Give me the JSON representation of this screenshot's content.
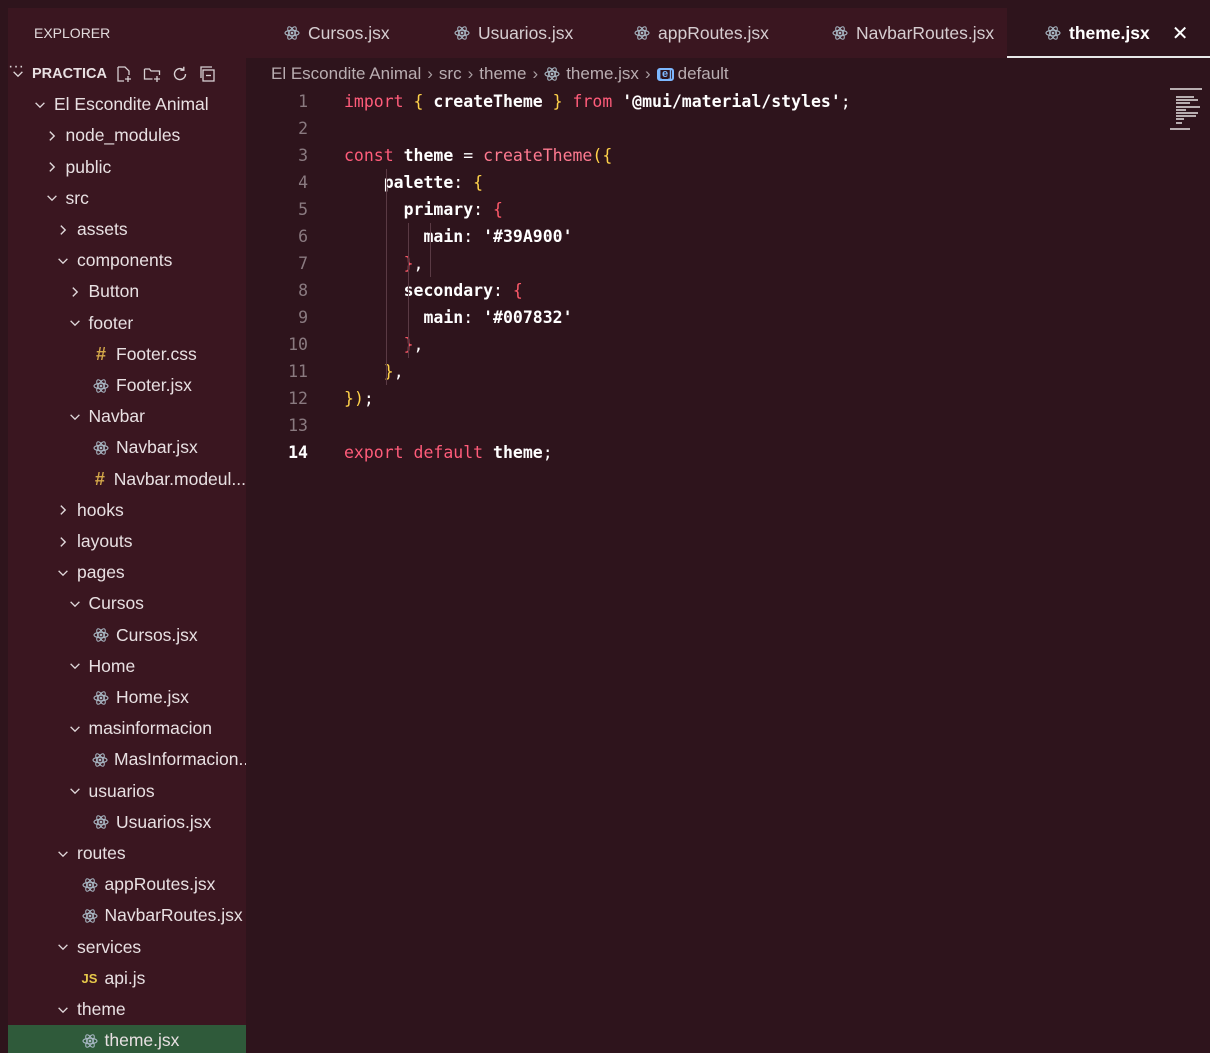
{
  "sidebar": {
    "title": "EXPLORER",
    "more": "···",
    "section": "PRACTICA",
    "items": [
      {
        "label": "El Escondite Animal",
        "type": "folder",
        "expanded": true,
        "indent": 0
      },
      {
        "label": "node_modules",
        "type": "folder",
        "expanded": false,
        "indent": 1
      },
      {
        "label": "public",
        "type": "folder",
        "expanded": false,
        "indent": 1
      },
      {
        "label": "src",
        "type": "folder",
        "expanded": true,
        "indent": 1
      },
      {
        "label": "assets",
        "type": "folder",
        "expanded": false,
        "indent": 2
      },
      {
        "label": "components",
        "type": "folder",
        "expanded": true,
        "indent": 2
      },
      {
        "label": "Button",
        "type": "folder",
        "expanded": false,
        "indent": 3
      },
      {
        "label": "footer",
        "type": "folder",
        "expanded": true,
        "indent": 3
      },
      {
        "label": "Footer.css",
        "type": "css",
        "indent": 4
      },
      {
        "label": "Footer.jsx",
        "type": "react",
        "indent": 4
      },
      {
        "label": "Navbar",
        "type": "folder",
        "expanded": true,
        "indent": 3
      },
      {
        "label": "Navbar.jsx",
        "type": "react",
        "indent": 4
      },
      {
        "label": "Navbar.modeul...",
        "type": "css",
        "indent": 4
      },
      {
        "label": "hooks",
        "type": "folder",
        "expanded": false,
        "indent": 2
      },
      {
        "label": "layouts",
        "type": "folder",
        "expanded": false,
        "indent": 2
      },
      {
        "label": "pages",
        "type": "folder",
        "expanded": true,
        "indent": 2
      },
      {
        "label": "Cursos",
        "type": "folder",
        "expanded": true,
        "indent": 3
      },
      {
        "label": "Cursos.jsx",
        "type": "react",
        "indent": 4
      },
      {
        "label": "Home",
        "type": "folder",
        "expanded": true,
        "indent": 3
      },
      {
        "label": "Home.jsx",
        "type": "react",
        "indent": 4
      },
      {
        "label": "masinformacion",
        "type": "folder",
        "expanded": true,
        "indent": 3
      },
      {
        "label": "MasInformacion...",
        "type": "react",
        "indent": 4
      },
      {
        "label": "usuarios",
        "type": "folder",
        "expanded": true,
        "indent": 3
      },
      {
        "label": "Usuarios.jsx",
        "type": "react",
        "indent": 4
      },
      {
        "label": "routes",
        "type": "folder",
        "expanded": true,
        "indent": 2
      },
      {
        "label": "appRoutes.jsx",
        "type": "react",
        "indent": 3
      },
      {
        "label": "NavbarRoutes.jsx",
        "type": "react",
        "indent": 3
      },
      {
        "label": "services",
        "type": "folder",
        "expanded": true,
        "indent": 2
      },
      {
        "label": "api.js",
        "type": "js",
        "indent": 3
      },
      {
        "label": "theme",
        "type": "folder",
        "expanded": true,
        "indent": 2
      },
      {
        "label": "theme.jsx",
        "type": "react",
        "indent": 3,
        "selected": true
      }
    ]
  },
  "tabs": [
    {
      "label": "Cursos.jsx",
      "active": false
    },
    {
      "label": "Usuarios.jsx",
      "active": false
    },
    {
      "label": "appRoutes.jsx",
      "active": false
    },
    {
      "label": "NavbarRoutes.jsx",
      "active": false
    },
    {
      "label": "theme.jsx",
      "active": true
    }
  ],
  "breadcrumb": {
    "parts": [
      "El Escondite Animal",
      "src",
      "theme",
      "theme.jsx",
      "default"
    ]
  },
  "editor": {
    "current_line": 14,
    "lines": [
      "import { createTheme } from '@mui/material/styles';",
      "",
      "const theme = createTheme({",
      "    palette: {",
      "      primary: {",
      "        main: '#39A900'",
      "      },",
      "      secondary: {",
      "        main: '#007832'",
      "      },",
      "    },",
      "});",
      "",
      "export default theme;"
    ]
  },
  "colors": {
    "background": "#2e141c",
    "sidebar": "#3a1620",
    "selection": "#2f5a3a",
    "react_icon": "#a9b8c4",
    "keyword": "#ff5c7a"
  }
}
